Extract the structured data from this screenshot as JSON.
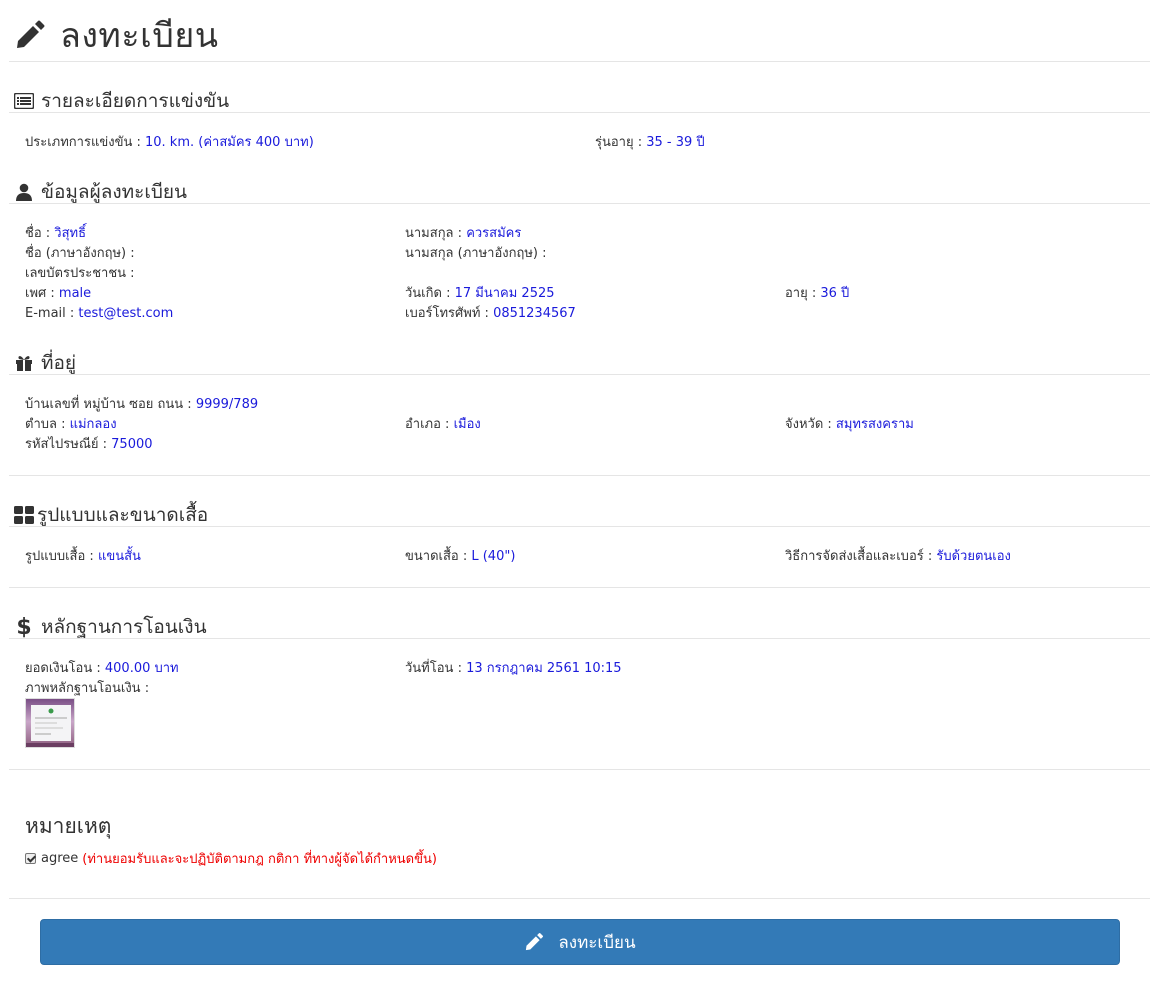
{
  "page": {
    "title": "ลงทะเบียน"
  },
  "sections": {
    "race": {
      "title": "รายละเอียดการแข่งขัน"
    },
    "registrant": {
      "title": "ข้อมูลผู้ลงทะเบียน"
    },
    "address": {
      "title": "ที่อยู่"
    },
    "shirt": {
      "title": "รูปแบบและขนาดเสื้อ"
    },
    "payment": {
      "title": "หลักฐานการโอนเงิน"
    }
  },
  "race": {
    "type_label": "ประเภทการแข่งขัน : ",
    "type_value": "10. km. (ค่าสมัคร 400 บาท)",
    "age_group_label": "รุ่นอายุ : ",
    "age_group_value": "35 - 39 ปี"
  },
  "registrant": {
    "first_name_label": "ชื่อ : ",
    "first_name_value": "วิสุทธิ์",
    "last_name_label": "นามสกุล : ",
    "last_name_value": "ควรสมัคร",
    "first_name_en_label": "ชื่อ (ภาษาอังกฤษ) :",
    "last_name_en_label": "นามสกุล (ภาษาอังกฤษ) :",
    "id_card_label": "เลขบัตรประชาชน :",
    "gender_label": "เพศ : ",
    "gender_value": "male",
    "birthdate_label": "วันเกิด : ",
    "birthdate_value": "17 มีนาคม 2525",
    "age_label": "อายุ : ",
    "age_value": "36 ปี",
    "email_label": "E-mail : ",
    "email_value": "test@test.com",
    "phone_label": "เบอร์โทรศัพท์ : ",
    "phone_value": "0851234567"
  },
  "address": {
    "house_label": "บ้านเลขที่ หมู่บ้าน ซอย ถนน : ",
    "house_value": "9999/789",
    "subdistrict_label": "ตำบล : ",
    "subdistrict_value": "แม่กลอง",
    "district_label": "อำเภอ : ",
    "district_value": "เมือง",
    "province_label": "จังหวัด : ",
    "province_value": "สมุทรสงคราม",
    "postcode_label": "รหัสไปรษณีย์ : ",
    "postcode_value": "75000"
  },
  "shirt": {
    "style_label": "รูปแบบเสื้อ : ",
    "style_value": "แขนสั้น",
    "size_label": "ขนาดเสื้อ : ",
    "size_value": "L (40\")",
    "delivery_label": "วิธีการจัดส่งเสื้อและเบอร์ : ",
    "delivery_value": "รับด้วยตนเอง"
  },
  "payment": {
    "amount_label": "ยอดเงินโอน : ",
    "amount_value": "400.00 บาท",
    "date_label": "วันที่โอน : ",
    "date_value": "13 กรกฎาคม 2561 10:15",
    "slip_label": "ภาพหลักฐานโอนเงิน :"
  },
  "note": {
    "title": "หมายเหตุ",
    "agree_label": "agree",
    "agree_checked": true,
    "agree_text": "(ท่านยอมรับและจะปฏิบัติตามกฎ กติกา ที่ทางผู้จัดได้กำหนดขึ้น)"
  },
  "submit": {
    "label": "ลงทะเบียน"
  },
  "icons": {
    "title": "pencil-icon",
    "race": "list-icon",
    "registrant": "user-icon",
    "address": "gift-icon",
    "shirt": "th-large-icon",
    "payment": "dollar-icon",
    "submit": "pencil-icon"
  },
  "colors": {
    "value": "#1a1adb",
    "agree_text": "#ee0000",
    "button": "#337ab7"
  }
}
